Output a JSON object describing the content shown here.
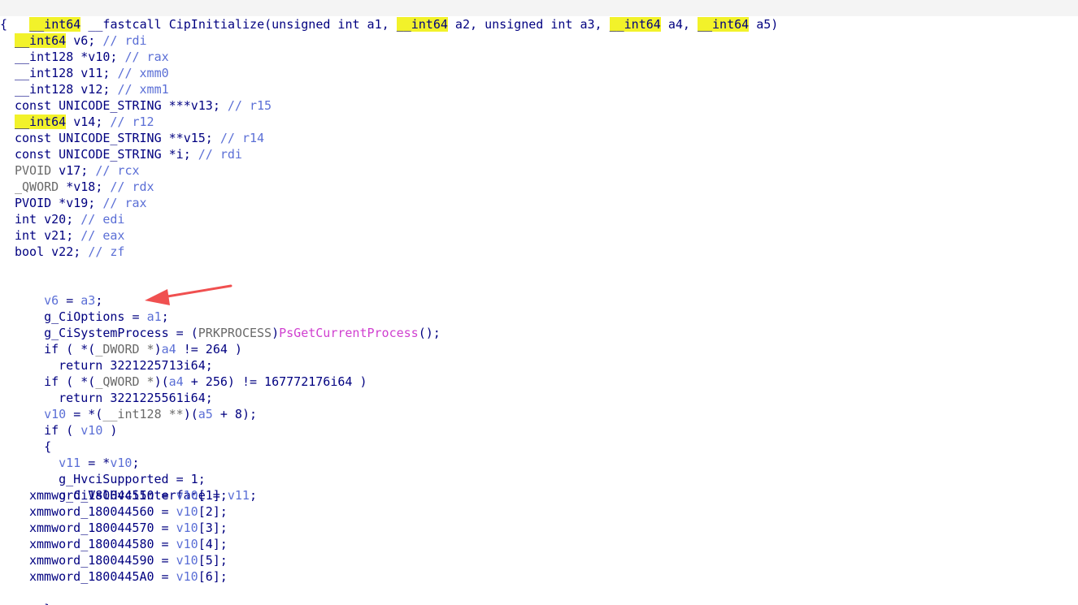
{
  "signature": {
    "ret_type": "__int64",
    "call_conv": " __fastcall ",
    "name": "CipInitialize",
    "open_paren": "(",
    "p1": "unsigned int a1, ",
    "p2_type": "__int64",
    "p2_name": " a2, ",
    "p3": "unsigned int a3, ",
    "p4_type": "__int64",
    "p4_name": " a4, ",
    "p5_type": "__int64",
    "p5_name": " a5",
    "close_paren": ")"
  },
  "open_brace": "{",
  "decls": [
    {
      "type": "__int64",
      "highlight": true,
      "rest": " v6; ",
      "comment": "// rdi"
    },
    {
      "type": "__int128",
      "highlight": false,
      "rest": " *v10; ",
      "comment": "// rax"
    },
    {
      "type": "__int128",
      "highlight": false,
      "rest": " v11; ",
      "comment": "// xmm0"
    },
    {
      "type": "__int128",
      "highlight": false,
      "rest": " v12; ",
      "comment": "// xmm1"
    },
    {
      "type": "const UNICODE_STRING",
      "highlight": false,
      "rest": " ***v13; ",
      "comment": "// r15"
    },
    {
      "type": "__int64",
      "highlight": true,
      "rest": " v14; ",
      "comment": "// r12"
    },
    {
      "type": "const UNICODE_STRING",
      "highlight": false,
      "rest": " **v15; ",
      "comment": "// r14"
    },
    {
      "type": "const UNICODE_STRING",
      "highlight": false,
      "rest": " *i; ",
      "comment": "// rdi"
    },
    {
      "type": "PVOID",
      "highlight": false,
      "grey": true,
      "rest": " v17; ",
      "comment": "// rcx"
    },
    {
      "type": "_QWORD",
      "highlight": false,
      "grey": true,
      "rest": " *v18; ",
      "comment": "// rdx"
    },
    {
      "type": "PVOID",
      "highlight": false,
      "rest": " *v19; ",
      "comment": "// rax"
    },
    {
      "type": "int",
      "highlight": false,
      "rest": " v20; ",
      "comment": "// edi"
    },
    {
      "type": "int",
      "highlight": false,
      "rest": " v21; ",
      "comment": "// eax"
    },
    {
      "type": "bool",
      "highlight": false,
      "rest": " v22; ",
      "comment": "// zf"
    }
  ],
  "body": {
    "l1_var": "v6",
    "l1_eq": " = ",
    "l1_rhs": "a3",
    "l1_end": ";",
    "l2_lhs": "g_CiOptions",
    "l2_eq": " = ",
    "l2_rhs": "a1",
    "l2_end": ";",
    "l3_lhs": "g_CiSystemProcess",
    "l3_eq": " = (",
    "l3_cast": "PRKPROCESS",
    "l3_mid": ")",
    "l3_func": "PsGetCurrentProcess",
    "l3_end": "();",
    "l4_a": "if ( *(",
    "l4_cast": "_DWORD *",
    "l4_b": ")",
    "l4_var": "a4",
    "l4_c": " != 264 )",
    "l5": "return 3221225713i64;",
    "l6_a": "if ( *(",
    "l6_cast": "_QWORD *",
    "l6_b": ")(",
    "l6_var": "a4",
    "l6_c": " + 256) != 167772176i64 )",
    "l7": "return 3221225561i64;",
    "l8_var": "v10",
    "l8_a": " = *(",
    "l8_cast": "__int128 **",
    "l8_b": ")(",
    "l8_var2": "a5",
    "l8_c": " + 8);",
    "l9_a": "if ( ",
    "l9_var": "v10",
    "l9_b": " )",
    "l10": "{",
    "l11_var": "v11",
    "l11_a": " = *",
    "l11_var2": "v10",
    "l11_end": ";",
    "l12": "g_HvciSupported = 1;",
    "l13_lhs": "g_CiVslHvciInterface",
    "l13_eq": " = ",
    "l13_var": "v11",
    "l13_end": ";",
    "xmm": [
      {
        "lhs": "xmmword_180044550",
        "var": "v10",
        "idx": "[1];"
      },
      {
        "lhs": "xmmword_180044560",
        "var": "v10",
        "idx": "[2];"
      },
      {
        "lhs": "xmmword_180044570",
        "var": "v10",
        "idx": "[3];"
      },
      {
        "lhs": "xmmword_180044580",
        "var": "v10",
        "idx": "[4];"
      },
      {
        "lhs": "xmmword_180044590",
        "var": "v10",
        "idx": "[5];"
      },
      {
        "lhs": "xmmword_1800445A0",
        "var": "v10",
        "idx": "[6];"
      }
    ],
    "xmm_eq": " = ",
    "l20": "}"
  },
  "colors": {
    "keyword": "#000080",
    "variable": "#5b6fd6",
    "highlight": "#f2f22a",
    "function": "#d040d0",
    "arrow": "#f05050"
  }
}
